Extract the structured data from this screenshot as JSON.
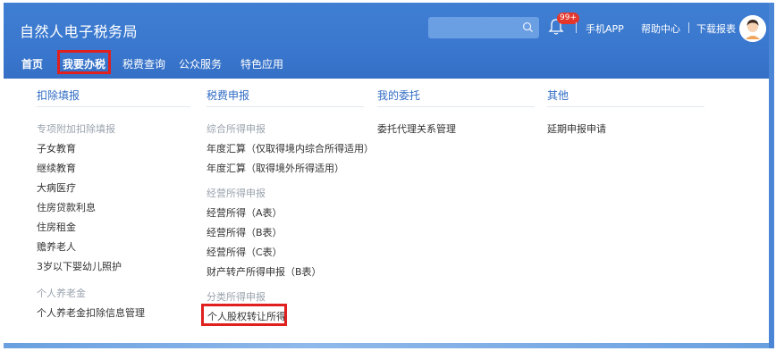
{
  "header": {
    "brand": "自然人电子税务局",
    "search": {
      "placeholder": ""
    },
    "notifications_badge": "99+",
    "links": [
      "手机APP",
      "帮助中心",
      "下载报表"
    ]
  },
  "nav": {
    "items": [
      "首页",
      "我要办税",
      "税费查询",
      "公众服务",
      "特色应用"
    ],
    "active": "我要办税"
  },
  "menu": {
    "col1": {
      "title": "扣除填报",
      "group1": "专项附加扣除填报",
      "items": [
        "子女教育",
        "继续教育",
        "大病医疗",
        "住房贷款利息",
        "住房租金",
        "赡养老人",
        "3岁以下婴幼儿照护"
      ],
      "group2": "个人养老金",
      "items2": [
        "个人养老金扣除信息管理"
      ]
    },
    "col2": {
      "title": "税费申报",
      "group1": "综合所得申报",
      "items": [
        "年度汇算（仅取得境内综合所得适用）",
        "年度汇算（取得境外所得适用）"
      ],
      "group2": "经营所得申报",
      "items2": [
        "经营所得（A表）",
        "经营所得（B表）",
        "经营所得（C表）",
        "财产转产所得申报（B表）"
      ],
      "group3": "分类所得申报",
      "items3": [
        "个人股权转让所得"
      ]
    },
    "col3": {
      "title": "我的委托",
      "items": [
        "委托代理关系管理"
      ]
    },
    "col4": {
      "title": "其他",
      "items": [
        "延期申报申请"
      ]
    }
  },
  "colors": {
    "header_blue": "#3a77ce",
    "link_blue": "#2f6bc4",
    "highlight_red": "#e01f1f"
  }
}
